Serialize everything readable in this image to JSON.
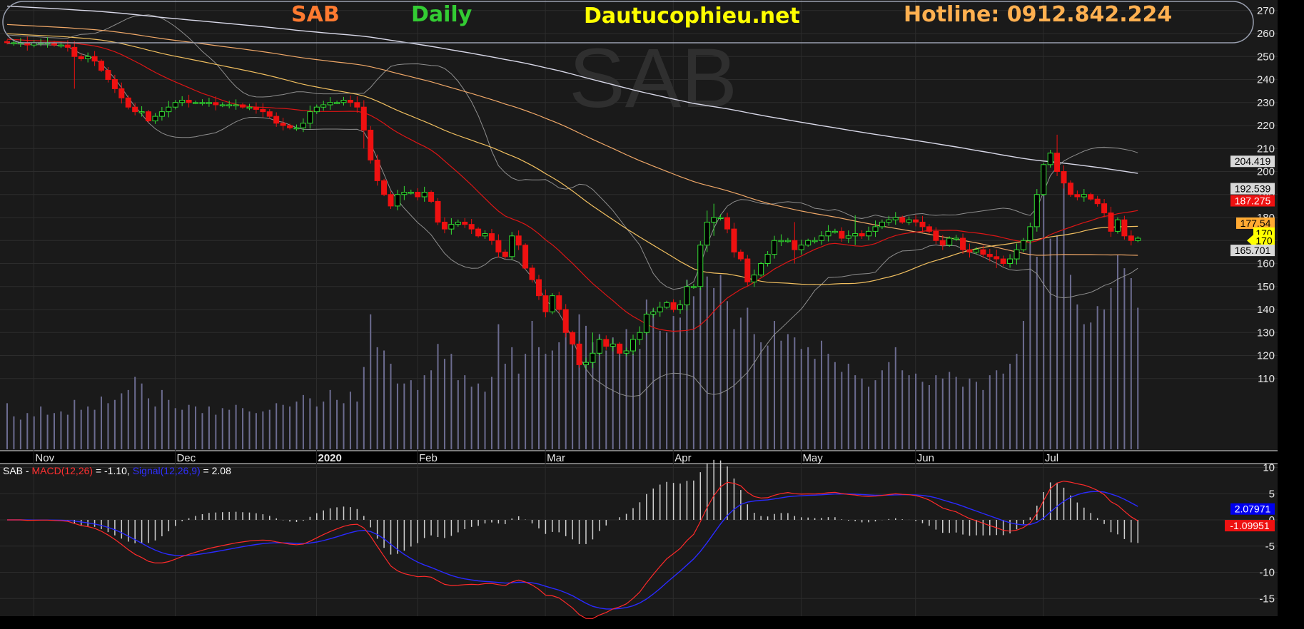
{
  "header": {
    "ticker": "SAB",
    "period": "Daily",
    "site": "Dautucophieu.net",
    "hotline": "Hotline: 0912.842.224",
    "watermark": "SAB",
    "colors": {
      "ticker": "#ff7a30",
      "period": "#33cc33",
      "site": "#ffff00",
      "hotline": "#ffb050"
    }
  },
  "macd_legend": {
    "ticker": "SAB",
    "sep": " - ",
    "macd_name": "MACD(12,26)",
    "macd_value": " = -1.10, ",
    "signal_name": "Signal(12,26,9)",
    "signal_value": " = 2.08"
  },
  "chart_data": [
    {
      "type": "candlestick",
      "panel": "price",
      "ylim": [
        104,
        272
      ],
      "y_ticks": [
        "270",
        "260",
        "250",
        "240",
        "230",
        "220",
        "210",
        "200",
        "190",
        "180",
        "170",
        "160",
        "150",
        "140",
        "130",
        "120",
        "110"
      ],
      "x_labels": [
        {
          "label": "Nov",
          "idx": 1
        },
        {
          "label": "Dec",
          "idx": 22
        },
        {
          "label": "2020",
          "idx": 43
        },
        {
          "label": "Feb",
          "idx": 58
        },
        {
          "label": "Mar",
          "idx": 77
        },
        {
          "label": "Apr",
          "idx": 96
        },
        {
          "label": "May",
          "idx": 115
        },
        {
          "label": "Jun",
          "idx": 132
        },
        {
          "label": "Jul",
          "idx": 151
        }
      ],
      "x_label_bold": [
        "2020"
      ],
      "closes": [
        256,
        256,
        256,
        255,
        256,
        256,
        256,
        255,
        255,
        254,
        250,
        249,
        250,
        248,
        244,
        240,
        236,
        232,
        228,
        226,
        226,
        222,
        224,
        226,
        228,
        230,
        231,
        230,
        230,
        230,
        230,
        229,
        229,
        229,
        229,
        228,
        228,
        227,
        226,
        224,
        221,
        220,
        219,
        219,
        221,
        226,
        228,
        229,
        230,
        230,
        231,
        230,
        228,
        218,
        205,
        196,
        190,
        185,
        190,
        191,
        191,
        189,
        191,
        187,
        178,
        175,
        177,
        178,
        177,
        175,
        172,
        173,
        170,
        165,
        163,
        172,
        168,
        158,
        153,
        146,
        139,
        146,
        140,
        130,
        125,
        116,
        117,
        121,
        127,
        124,
        125,
        121,
        122,
        127,
        130,
        138,
        139,
        141,
        143,
        140,
        142,
        150,
        150,
        168,
        178,
        180,
        180,
        175,
        165,
        162,
        152,
        155,
        160,
        164,
        170,
        170,
        170,
        166,
        168,
        170,
        170,
        172,
        174,
        174,
        171,
        172,
        173,
        172,
        174,
        176,
        178,
        179,
        180,
        178,
        179,
        178,
        176,
        174,
        170,
        168,
        171,
        171,
        166,
        165,
        166,
        164,
        163,
        162,
        160,
        162,
        166,
        170,
        176,
        190,
        203,
        208,
        200,
        195,
        190,
        189,
        190,
        188,
        186,
        182,
        174,
        179,
        172,
        170,
        171
      ],
      "volume_max": 182000,
      "volumes": [
        28000,
        20000,
        18000,
        22000,
        20000,
        26000,
        21000,
        22000,
        23000,
        21000,
        30000,
        24000,
        26000,
        24000,
        32000,
        28000,
        30000,
        34000,
        36000,
        44000,
        40000,
        31000,
        26000,
        36000,
        30000,
        25000,
        24000,
        27000,
        26000,
        22000,
        26000,
        21000,
        25000,
        24000,
        27000,
        25000,
        23000,
        22000,
        23000,
        24000,
        28000,
        27000,
        26000,
        29000,
        33000,
        31000,
        26000,
        29000,
        36000,
        30000,
        28000,
        35000,
        29000,
        50000,
        82000,
        62000,
        60000,
        52000,
        40000,
        40000,
        42000,
        36000,
        45000,
        48000,
        64000,
        55000,
        58000,
        42000,
        45000,
        38000,
        40000,
        35000,
        44000,
        76000,
        52000,
        62000,
        46000,
        58000,
        78000,
        62000,
        58000,
        60000,
        65000,
        72000,
        71000,
        82000,
        75000,
        65000,
        70000,
        60000,
        68000,
        63000,
        73000,
        58000,
        61000,
        91000,
        85000,
        72000,
        71000,
        81000,
        80000,
        103000,
        93000,
        98000,
        105000,
        98000,
        106000,
        90000,
        73000,
        80000,
        86000,
        70000,
        65000,
        63000,
        78000,
        66000,
        70000,
        68000,
        61000,
        62000,
        55000,
        66000,
        58000,
        53000,
        47000,
        52000,
        45000,
        43000,
        38000,
        42000,
        48000,
        53000,
        62000,
        48000,
        45000,
        46000,
        41000,
        39000,
        45000,
        43000,
        47000,
        44000,
        38000,
        43000,
        41000,
        36000,
        45000,
        48000,
        46000,
        52000,
        58000,
        78000,
        130000,
        117000,
        155000,
        128000,
        130000,
        163000,
        106000,
        88000,
        76000,
        77000,
        87000,
        85000,
        98000,
        118000,
        110000,
        104000,
        86000
      ],
      "series": [
        {
          "name": "MA200",
          "period": 200,
          "color": "#d8d8e8"
        },
        {
          "name": "MA100",
          "period": 100,
          "color": "#f0a868"
        },
        {
          "name": "MA50",
          "period": 50,
          "color": "#f2c060"
        },
        {
          "name": "MA20",
          "period": 20,
          "color": "#dd1515"
        },
        {
          "name": "BB",
          "period": 20,
          "color": "#8e8e8e"
        }
      ],
      "badges": [
        {
          "text": "204.419",
          "value": 204.419,
          "bg": "#d8d8d8",
          "fg": "#000000"
        },
        {
          "text": "192.539",
          "value": 192.539,
          "bg": "#d8d8d8",
          "fg": "#000000"
        },
        {
          "text": "187.275",
          "value": 187.275,
          "bg": "#ee1111",
          "fg": "#ffffff"
        },
        {
          "text": "177.54",
          "value": 177.54,
          "bg": "#ffaa33",
          "fg": "#000000"
        },
        {
          "text": "170",
          "value": 173.2,
          "bg": "#ffff00",
          "fg": "#000000"
        },
        {
          "text": "170",
          "value": 170,
          "bg": "#ffff00",
          "fg": "#000000",
          "pointer": true
        },
        {
          "text": "165.701",
          "value": 165.701,
          "bg": "#d8d8d8",
          "fg": "#000000"
        }
      ]
    },
    {
      "type": "line",
      "panel": "macd",
      "ylim": [
        -19.5,
        12
      ],
      "y_ticks": [
        "10",
        "5",
        "0",
        "-5",
        "-10",
        "-15"
      ],
      "series": [
        {
          "name": "MACD(12,26)",
          "color": "#ff2a2a"
        },
        {
          "name": "Signal(12,26,9)",
          "color": "#2a2aff"
        },
        {
          "name": "Histogram",
          "color": "#d0d0d0"
        }
      ],
      "badges": [
        {
          "text": "2.07971",
          "value": 2.08,
          "bg": "#0000ee",
          "fg": "#ffffff"
        },
        {
          "text": "-1.09951",
          "value": -1.1,
          "bg": "#ee1111",
          "fg": "#ffffff"
        }
      ]
    }
  ]
}
